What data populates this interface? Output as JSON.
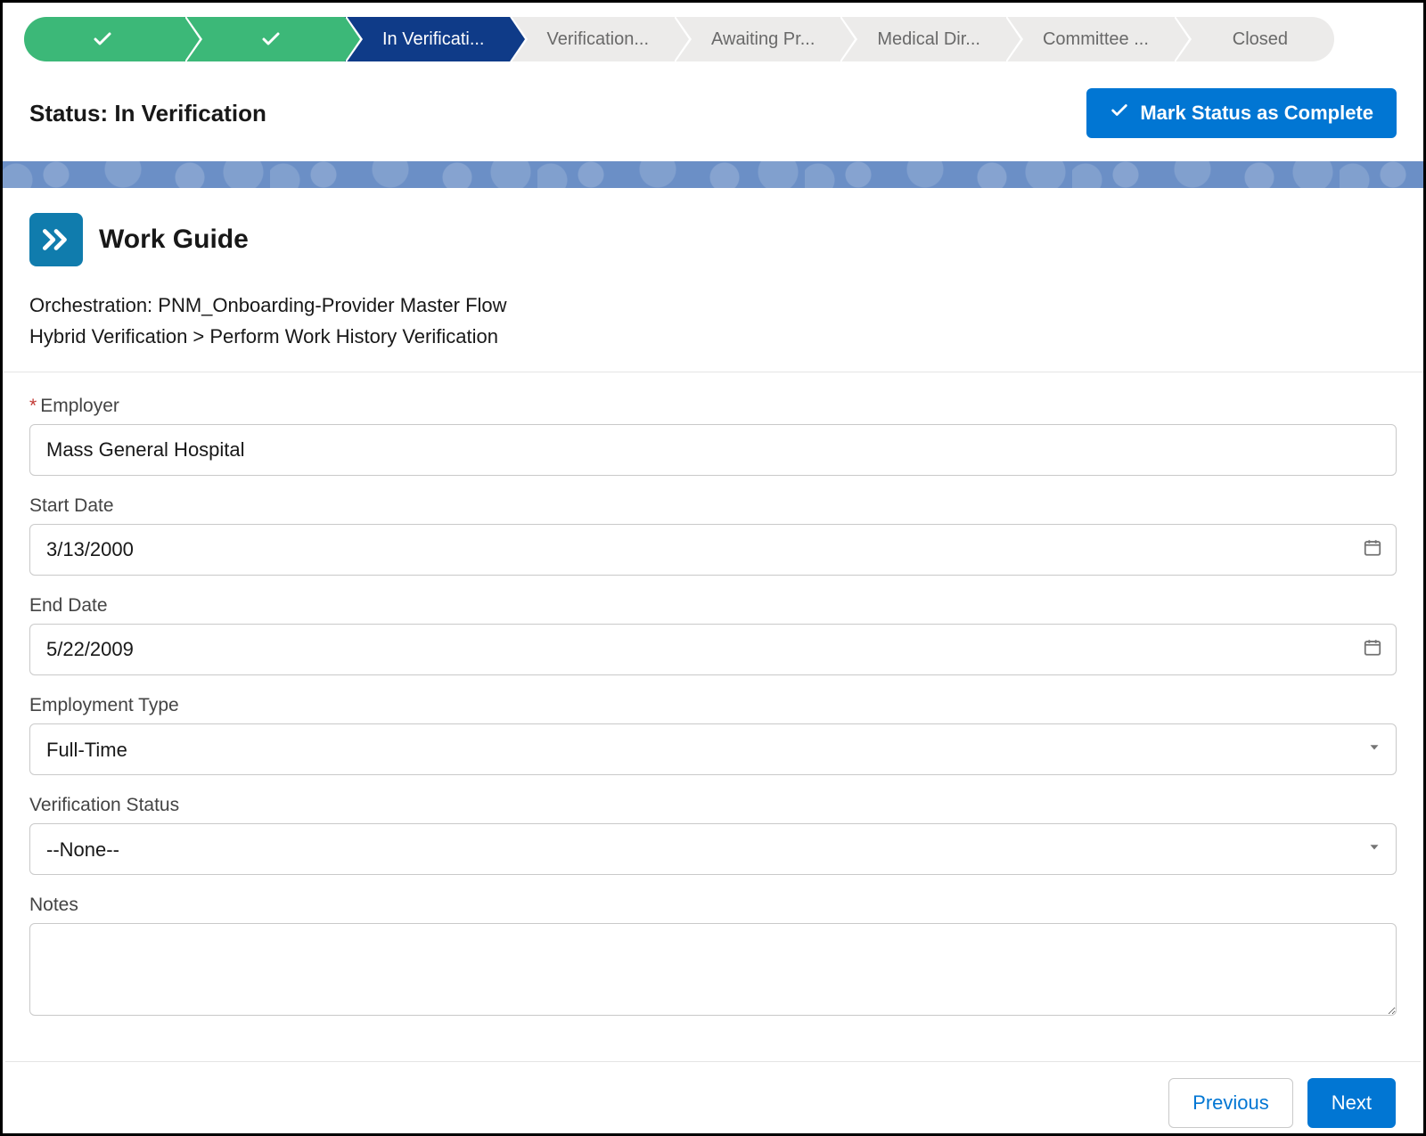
{
  "path": {
    "steps": [
      {
        "label": "",
        "state": "complete"
      },
      {
        "label": "",
        "state": "complete"
      },
      {
        "label": "In Verificati...",
        "state": "active"
      },
      {
        "label": "Verification...",
        "state": "pending"
      },
      {
        "label": "Awaiting Pr...",
        "state": "pending"
      },
      {
        "label": "Medical Dir...",
        "state": "pending"
      },
      {
        "label": "Committee ...",
        "state": "pending"
      },
      {
        "label": "Closed",
        "state": "pending"
      }
    ]
  },
  "status": {
    "label": "Status: In Verification",
    "mark_complete_label": "Mark Status as Complete"
  },
  "guide": {
    "title": "Work Guide",
    "orchestration_line": "Orchestration: PNM_Onboarding-Provider Master Flow",
    "breadcrumb_line": "Hybrid Verification > Perform Work History Verification"
  },
  "form": {
    "employer": {
      "label": "Employer",
      "required": true,
      "value": "Mass General Hospital"
    },
    "start_date": {
      "label": "Start Date",
      "value": "3/13/2000"
    },
    "end_date": {
      "label": "End Date",
      "value": "5/22/2009"
    },
    "employment_type": {
      "label": "Employment Type",
      "value": "Full-Time"
    },
    "verification_status": {
      "label": "Verification Status",
      "value": "--None--"
    },
    "notes": {
      "label": "Notes",
      "value": ""
    }
  },
  "footer": {
    "previous": "Previous",
    "next": "Next"
  }
}
